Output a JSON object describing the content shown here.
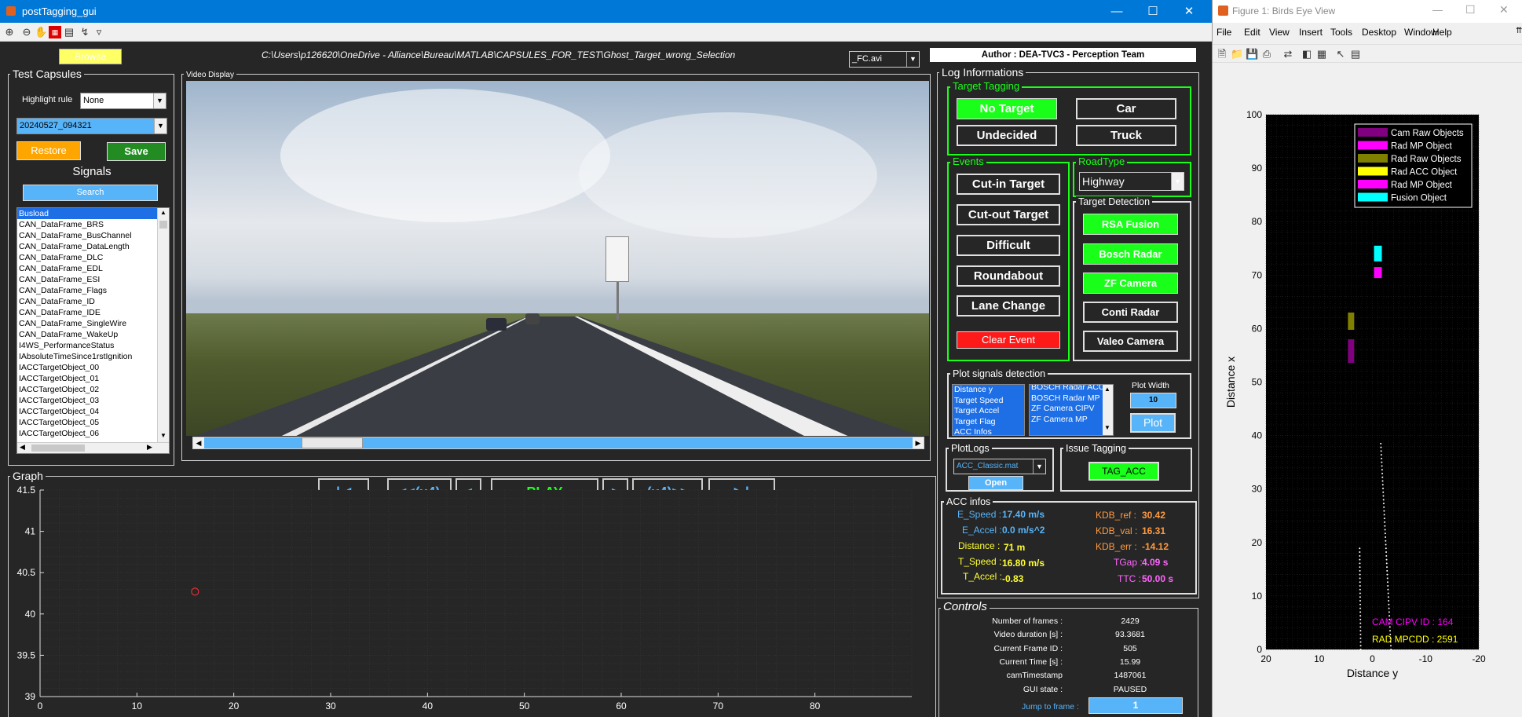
{
  "main_window": {
    "title": "postTagging_gui",
    "path_text": "C:\\Users\\p126620\\OneDrive - Alliance\\Bureau\\MATLAB\\CAPSULES_FOR_TEST\\Ghost_Target_wrong_Selection",
    "browse_label": "Browse",
    "video_file": "_FC.avi",
    "author": "Author : DEA-TVC3 - Perception Team"
  },
  "test_capsules": {
    "title": "Test Capsules",
    "highlight_label": "Highlight rule",
    "highlight_value": "None",
    "capsule_value": "20240527_094321",
    "restore_label": "Restore",
    "save_label": "Save",
    "signals_label": "Signals",
    "search_label": "Search",
    "signals": [
      "Busload",
      "CAN_DataFrame_BRS",
      "CAN_DataFrame_BusChannel",
      "CAN_DataFrame_DataLength",
      "CAN_DataFrame_DLC",
      "CAN_DataFrame_EDL",
      "CAN_DataFrame_ESI",
      "CAN_DataFrame_Flags",
      "CAN_DataFrame_ID",
      "CAN_DataFrame_IDE",
      "CAN_DataFrame_SingleWire",
      "CAN_DataFrame_WakeUp",
      "I4WS_PerformanceStatus",
      "IAbsoluteTimeSince1rstIgnition",
      "IACCTargetObject_00",
      "IACCTargetObject_01",
      "IACCTargetObject_02",
      "IACCTargetObject_03",
      "IACCTargetObject_04",
      "IACCTargetObject_05",
      "IACCTargetObject_06"
    ]
  },
  "video": {
    "title": "Video Display",
    "btn_first": "|◀",
    "btn_rew4": "<<(x4)",
    "btn_prev": "<",
    "btn_play": "PLAY",
    "btn_next": ">",
    "btn_ff4": "(x4)>>",
    "btn_last": "▶|",
    "progress": 0.15
  },
  "graph": {
    "title": "Graph"
  },
  "chart_data": {
    "type": "scatter",
    "x_ticks": [
      "0",
      "10",
      "20",
      "30",
      "40",
      "50",
      "60",
      "70",
      "80"
    ],
    "y_ticks": [
      "41.5",
      "41",
      "40.5",
      "40",
      "39.5",
      "39"
    ],
    "xlim": [
      0,
      90
    ],
    "ylim": [
      39,
      41.5
    ],
    "points": [
      {
        "x": 16,
        "y": 40.27
      }
    ],
    "grid": true
  },
  "log": {
    "title": "Log Informations",
    "target_tagging_title": "Target Tagging",
    "tag_no_target": "No Target",
    "tag_car": "Car",
    "tag_undecided": "Undecided",
    "tag_truck": "Truck",
    "events_title": "Events",
    "ev_cutin": "Cut-in Target",
    "ev_cutout": "Cut-out Target",
    "ev_difficult": "Difficult",
    "ev_roundabout": "Roundabout",
    "ev_lane": "Lane Change",
    "ev_clear": "Clear Event",
    "roadtype_title": "RoadType",
    "roadtype_value": "Highway",
    "detection_title": "Target Detection",
    "det_rsa": "RSA Fusion",
    "det_bosch": "Bosch Radar",
    "det_zf": "ZF Camera",
    "det_conti": "Conti Radar",
    "det_valeo": "Valeo Camera",
    "plot_signals_title": "Plot signals detection",
    "plot_list1": [
      "Distance y",
      "Target Speed",
      "Target Accel",
      "Target Flag",
      "ACC Infos"
    ],
    "plot_list2": [
      "BOSCH Radar ACC",
      "BOSCH Radar MP",
      "ZF Camera CIPV",
      "ZF Camera MP"
    ],
    "plot_width_label": "Plot Width",
    "plot_width_value": "10",
    "plot_label": "Plot",
    "plotlogs_title": "PlotLogs",
    "plotlogs_value": "ACC_Classic.mat",
    "open_label": "Open",
    "issue_title": "Issue Tagging",
    "issue_btn": "TAG_ACC",
    "acc_title": "ACC infos",
    "e_speed_label": "E_Speed :",
    "e_speed": "17.40 m/s",
    "e_accel_label": "E_Accel :",
    "e_accel": "0.0 m/s^2",
    "distance_label": "Distance :",
    "distance": "71 m",
    "t_speed_label": "T_Speed :",
    "t_speed": "16.80 m/s",
    "t_accel_label": "T_Accel :",
    "t_accel": "-0.83",
    "kdb_ref_label": "KDB_ref :",
    "kdb_ref": "30.42",
    "kdb_val_label": "KDB_val :",
    "kdb_val": "16.31",
    "kdb_err_label": "KDB_err :",
    "kdb_err": "-14.12",
    "tgap_label": "TGap :",
    "tgap": "4.09 s",
    "ttc_label": "TTC :",
    "ttc": "50.00 s",
    "colors": {
      "blue": "#58b4f8",
      "yellow": "#ffff33",
      "orange": "#ff9a40",
      "pink": "#ff66ff"
    }
  },
  "controls": {
    "title": "Controls",
    "rows": [
      {
        "label": "Number of frames :",
        "value": "2429"
      },
      {
        "label": "Video duration [s] :",
        "value": "93.3681"
      },
      {
        "label": "Current Frame ID :",
        "value": "505"
      },
      {
        "label": "Current Time [s] :",
        "value": "15.99"
      },
      {
        "label": "camTimestamp",
        "value": "1487061"
      },
      {
        "label": "GUI state :",
        "value": "PAUSED"
      }
    ],
    "jump_label": "Jump to frame :",
    "jump_value": "1"
  },
  "figure": {
    "title": "Figure 1: Birds Eye View",
    "menu": [
      "File",
      "Edit",
      "View",
      "Insert",
      "Tools",
      "Desktop",
      "Window",
      "Help"
    ],
    "legend": [
      {
        "label": "Cam Raw Objects",
        "color": "#800080"
      },
      {
        "label": "Rad MP Object",
        "color": "#ff00ff"
      },
      {
        "label": "Rad Raw Objects",
        "color": "#808000"
      },
      {
        "label": "Rad ACC Object",
        "color": "#ffff00"
      },
      {
        "label": "Rad MP Object",
        "color": "#ff00ff"
      },
      {
        "label": "Fusion Object",
        "color": "#00ffff"
      }
    ],
    "y_ticks": [
      "100",
      "90",
      "80",
      "70",
      "60",
      "50",
      "40",
      "30",
      "20",
      "10",
      "0"
    ],
    "x_ticks": [
      "20",
      "10",
      "0",
      "-10",
      "-20"
    ],
    "xlabel": "Distance y",
    "ylabel": "Distance x",
    "cam_cipv": "CAM CIPV ID : 164",
    "rad_mpcdd": "RAD MPCDD : 2591"
  }
}
